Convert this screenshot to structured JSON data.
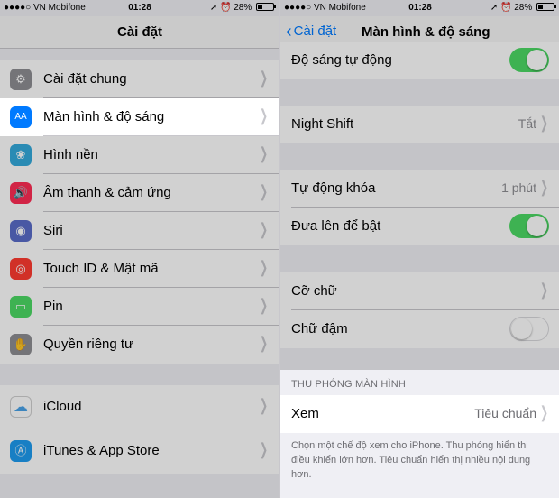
{
  "left": {
    "status": {
      "carrier": "●●●●○ VN Mobifone",
      "time": "01:28",
      "battery": "28%"
    },
    "title": "Cài đặt",
    "group1": [
      {
        "label": "Cài đặt chung",
        "icon": "gear-icon",
        "color": "#8e8e93",
        "glyph": "⚙"
      },
      {
        "label": "Màn hình & độ sáng",
        "icon": "display-brightness-icon",
        "color": "#007aff",
        "glyph": "AA",
        "highlighted": true
      },
      {
        "label": "Hình nền",
        "icon": "wallpaper-icon",
        "color": "#34aadc",
        "glyph": "❀"
      },
      {
        "label": "Âm thanh & cảm ứng",
        "icon": "sound-icon",
        "color": "#ff2d55",
        "glyph": "🔊"
      },
      {
        "label": "Siri",
        "icon": "siri-icon",
        "color": "#5a6cc8",
        "glyph": "◉"
      },
      {
        "label": "Touch ID & Mật mã",
        "icon": "fingerprint-icon",
        "color": "#ff3b30",
        "glyph": "◎"
      },
      {
        "label": "Pin",
        "icon": "battery-icon",
        "color": "#4cd964",
        "glyph": "▭"
      },
      {
        "label": "Quyền riêng tư",
        "icon": "privacy-hand-icon",
        "color": "#8e8e93",
        "glyph": "✋"
      }
    ],
    "group2": [
      {
        "label": "iCloud",
        "icon": "icloud-icon",
        "color": "#ffffff",
        "glyph": "☁"
      },
      {
        "label": "iTunes & App Store",
        "icon": "app-store-icon",
        "color": "#1e9bf0",
        "glyph": "Ⓐ"
      }
    ]
  },
  "right": {
    "status": {
      "carrier": "●●●●○ VN Mobifone",
      "time": "01:28",
      "battery": "28%"
    },
    "back_label": "Cài đặt",
    "title": "Màn hình & độ sáng",
    "auto_brightness": {
      "label": "Độ sáng tự động",
      "on": true
    },
    "night_shift": {
      "label": "Night Shift",
      "value": "Tắt"
    },
    "auto_lock": {
      "label": "Tự động khóa",
      "value": "1 phút"
    },
    "raise_to_wake": {
      "label": "Đưa lên để bật",
      "on": true
    },
    "text_size": {
      "label": "Cỡ chữ"
    },
    "bold_text": {
      "label": "Chữ đậm",
      "on": false
    },
    "zoom_header": "THU PHÓNG MÀN HÌNH",
    "view": {
      "label": "Xem",
      "value": "Tiêu chuẩn"
    },
    "footnote": "Chọn một chế độ xem cho iPhone. Thu phóng hiển thị điều khiển lớn hơn. Tiêu chuẩn hiển thị nhiều nội dung hơn."
  }
}
